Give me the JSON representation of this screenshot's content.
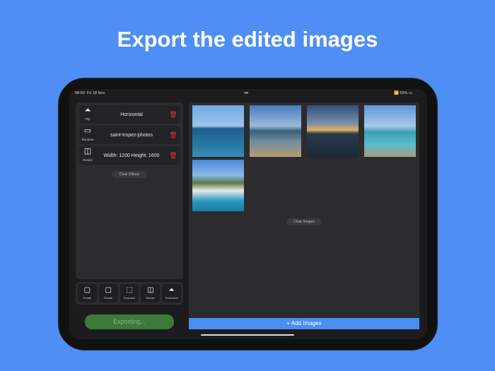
{
  "headline": "Export the edited images",
  "status": {
    "time": "08:50",
    "date": "Fri 18 Nov",
    "battery": "59%"
  },
  "effects": [
    {
      "icon": "flip-icon",
      "glyph": "⏶",
      "label": "Flip",
      "value": "Horizontal"
    },
    {
      "icon": "rename-icon",
      "glyph": "▭",
      "label": "Rename",
      "value": "saint-tropez-photos"
    },
    {
      "icon": "resize-icon",
      "glyph": "◫",
      "label": "Resize",
      "value": "Width:  1200  Height:  1600"
    }
  ],
  "clear_effects": "Clear Effects",
  "tools": [
    {
      "glyph": "▢",
      "label": "Rotate"
    },
    {
      "glyph": "▢",
      "label": "Rotate"
    },
    {
      "glyph": "⬚",
      "label": "Rounded"
    },
    {
      "glyph": "◫",
      "label": "Resize"
    },
    {
      "glyph": "⏶",
      "label": "Horizontal"
    }
  ],
  "export_label": "Exporting...",
  "clear_images": "Clear Images",
  "add_images": "+ Add Images",
  "colors": {
    "background": "#4f8ef5",
    "accent": "#4a8ef2",
    "export": "#3c7a3a",
    "trash": "#dd3333"
  }
}
